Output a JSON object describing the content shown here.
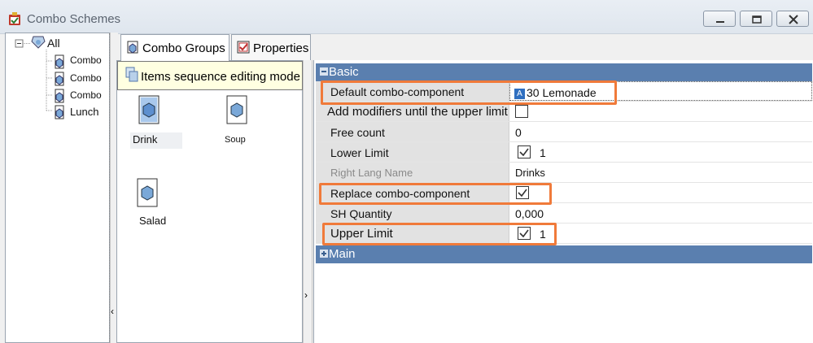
{
  "window": {
    "title": "Combo Schemes",
    "controls": {
      "minimize": "minimize",
      "maximize": "maximize",
      "close": "close"
    }
  },
  "tree": {
    "root": "All",
    "items": [
      "Combo",
      "Combo",
      "Combo",
      "Lunch"
    ]
  },
  "tabs": [
    {
      "label": "Combo Groups",
      "icon": "combo-groups-icon",
      "active": true
    },
    {
      "label": "Properties",
      "icon": "properties-icon",
      "active": false
    }
  ],
  "tooltip": {
    "text": "Items sequence editing mode"
  },
  "groups": [
    {
      "label": "Drink",
      "selected": true
    },
    {
      "label": "Soup",
      "selected": false
    },
    {
      "label": "Salad",
      "selected": false
    }
  ],
  "properties": {
    "basic_category": "Basic",
    "main_category": "Main",
    "rows": [
      {
        "name": "Default combo-component",
        "value": "30 Lemonade",
        "value_icon": "A",
        "type": "text"
      },
      {
        "name": "Add modifiers until the upper limit",
        "value": "",
        "type": "checkbox",
        "checked": false
      },
      {
        "name": "Free count",
        "value": "0",
        "type": "text"
      },
      {
        "name": "Lower Limit",
        "value": "1",
        "type": "checkbox",
        "checked": true
      },
      {
        "name": "Right Lang Name",
        "value": "Drinks",
        "type": "text",
        "dim": true
      },
      {
        "name": "Replace combo-component",
        "value": "",
        "type": "checkbox",
        "checked": true
      },
      {
        "name": "SH Quantity",
        "value": "0,000",
        "type": "text"
      },
      {
        "name": "Upper Limit",
        "value": "1",
        "type": "checkbox",
        "checked": true
      }
    ]
  },
  "colors": {
    "category_header": "#5a7faf",
    "highlight": "#f07a3a",
    "tooltip_bg": "#ffffe1"
  }
}
